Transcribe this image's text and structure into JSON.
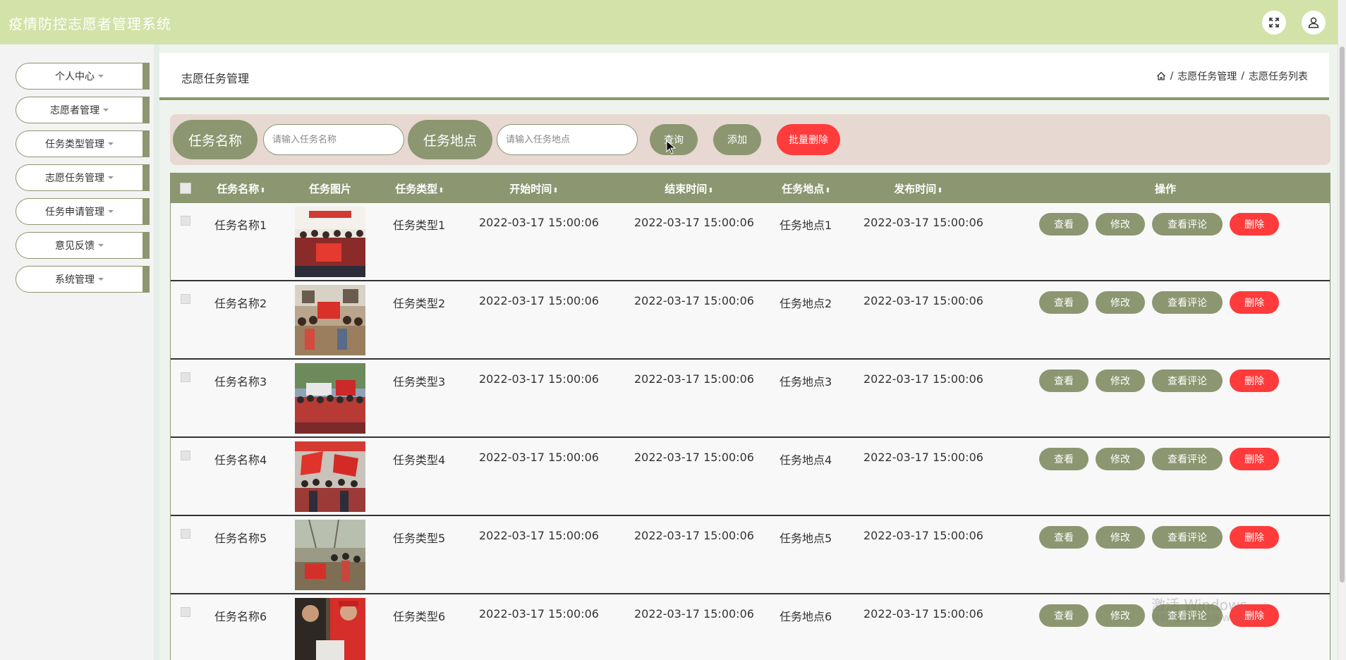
{
  "app": {
    "title": "疫情防控志愿者管理系统"
  },
  "topbar": {
    "fullscreen_icon": "fullscreen-icon",
    "user_icon": "user-icon"
  },
  "sidebar": {
    "items": [
      {
        "label": "个人中心"
      },
      {
        "label": "志愿者管理"
      },
      {
        "label": "任务类型管理"
      },
      {
        "label": "志愿任务管理"
      },
      {
        "label": "任务申请管理"
      },
      {
        "label": "意见反馈"
      },
      {
        "label": "系统管理"
      }
    ]
  },
  "breadcrumb": {
    "title": "志愿任务管理",
    "separator": "/",
    "path": [
      "志愿任务管理",
      "志愿任务列表"
    ]
  },
  "search": {
    "name_label": "任务名称",
    "name_placeholder": "请输入任务名称",
    "location_label": "任务地点",
    "location_placeholder": "请输入任务地点",
    "query_button": "查询",
    "add_button": "添加",
    "batch_delete_button": "批量删除"
  },
  "table": {
    "headers": {
      "name": "任务名称",
      "image": "任务图片",
      "type": "任务类型",
      "start": "开始时间",
      "end": "结束时间",
      "location": "任务地点",
      "published": "发布时间",
      "actions": "操作"
    },
    "sort_glyph": "⬍",
    "action_labels": {
      "view": "查看",
      "edit": "修改",
      "comments": "查看评论",
      "delete": "删除"
    },
    "rows": [
      {
        "name": "任务名称1",
        "type": "任务类型1",
        "start": "2022-03-17 15:00:06",
        "end": "2022-03-17 15:00:06",
        "location": "任务地点1",
        "published": "2022-03-17 15:00:06"
      },
      {
        "name": "任务名称2",
        "type": "任务类型2",
        "start": "2022-03-17 15:00:06",
        "end": "2022-03-17 15:00:06",
        "location": "任务地点2",
        "published": "2022-03-17 15:00:06"
      },
      {
        "name": "任务名称3",
        "type": "任务类型3",
        "start": "2022-03-17 15:00:06",
        "end": "2022-03-17 15:00:06",
        "location": "任务地点3",
        "published": "2022-03-17 15:00:06"
      },
      {
        "name": "任务名称4",
        "type": "任务类型4",
        "start": "2022-03-17 15:00:06",
        "end": "2022-03-17 15:00:06",
        "location": "任务地点4",
        "published": "2022-03-17 15:00:06"
      },
      {
        "name": "任务名称5",
        "type": "任务类型5",
        "start": "2022-03-17 15:00:06",
        "end": "2022-03-17 15:00:06",
        "location": "任务地点5",
        "published": "2022-03-17 15:00:06"
      },
      {
        "name": "任务名称6",
        "type": "任务类型6",
        "start": "2022-03-17 15:00:06",
        "end": "2022-03-17 15:00:06",
        "location": "任务地点6",
        "published": "2022-03-17 15:00:06"
      }
    ]
  },
  "watermark": {
    "line1": "激活 Windows",
    "line2": "转到“设置”以激活 Windows。"
  },
  "colors": {
    "topbar": "#d3e2a8",
    "olive": "#8c9670",
    "danger": "#ff3b3b",
    "search_bg": "#e7d8d2"
  }
}
